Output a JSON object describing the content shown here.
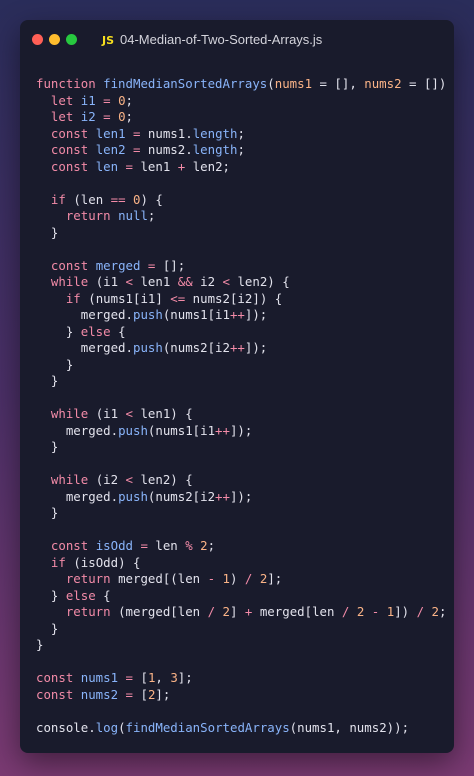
{
  "window": {
    "filename": "04-Median-of-Two-Sorted-Arrays.js",
    "language_badge": "JS"
  },
  "code_lines": [
    [
      [
        "kw",
        "function "
      ],
      [
        "fn",
        "findMedianSortedArrays"
      ],
      [
        "plain",
        "("
      ],
      [
        "param",
        "nums1"
      ],
      [
        "plain",
        " = [], "
      ],
      [
        "param",
        "nums2"
      ],
      [
        "plain",
        " = []) {"
      ]
    ],
    [
      [
        "plain",
        "  "
      ],
      [
        "kw",
        "let "
      ],
      [
        "var",
        "i1"
      ],
      [
        "op",
        " = "
      ],
      [
        "num",
        "0"
      ],
      [
        "plain",
        ";"
      ]
    ],
    [
      [
        "plain",
        "  "
      ],
      [
        "kw",
        "let "
      ],
      [
        "var",
        "i2"
      ],
      [
        "op",
        " = "
      ],
      [
        "num",
        "0"
      ],
      [
        "plain",
        ";"
      ]
    ],
    [
      [
        "plain",
        "  "
      ],
      [
        "kw",
        "const "
      ],
      [
        "var",
        "len1"
      ],
      [
        "op",
        " = "
      ],
      [
        "plain",
        "nums1."
      ],
      [
        "prop",
        "length"
      ],
      [
        "plain",
        ";"
      ]
    ],
    [
      [
        "plain",
        "  "
      ],
      [
        "kw",
        "const "
      ],
      [
        "var",
        "len2"
      ],
      [
        "op",
        " = "
      ],
      [
        "plain",
        "nums2."
      ],
      [
        "prop",
        "length"
      ],
      [
        "plain",
        ";"
      ]
    ],
    [
      [
        "plain",
        "  "
      ],
      [
        "kw",
        "const "
      ],
      [
        "var",
        "len"
      ],
      [
        "op",
        " = "
      ],
      [
        "plain",
        "len1 "
      ],
      [
        "op",
        "+"
      ],
      [
        "plain",
        " len2;"
      ]
    ],
    [],
    [
      [
        "plain",
        "  "
      ],
      [
        "kw",
        "if "
      ],
      [
        "plain",
        "(len "
      ],
      [
        "op",
        "=="
      ],
      [
        "plain",
        " "
      ],
      [
        "num",
        "0"
      ],
      [
        "plain",
        ") {"
      ]
    ],
    [
      [
        "plain",
        "    "
      ],
      [
        "kw",
        "return "
      ],
      [
        "var",
        "null"
      ],
      [
        "plain",
        ";"
      ]
    ],
    [
      [
        "plain",
        "  }"
      ]
    ],
    [],
    [
      [
        "plain",
        "  "
      ],
      [
        "kw",
        "const "
      ],
      [
        "var",
        "merged"
      ],
      [
        "op",
        " = "
      ],
      [
        "plain",
        "[];"
      ]
    ],
    [
      [
        "plain",
        "  "
      ],
      [
        "kw",
        "while "
      ],
      [
        "plain",
        "(i1 "
      ],
      [
        "op",
        "<"
      ],
      [
        "plain",
        " len1 "
      ],
      [
        "op",
        "&&"
      ],
      [
        "plain",
        " i2 "
      ],
      [
        "op",
        "<"
      ],
      [
        "plain",
        " len2) {"
      ]
    ],
    [
      [
        "plain",
        "    "
      ],
      [
        "kw",
        "if "
      ],
      [
        "plain",
        "(nums1[i1] "
      ],
      [
        "op",
        "<="
      ],
      [
        "plain",
        " nums2[i2]) {"
      ]
    ],
    [
      [
        "plain",
        "      merged."
      ],
      [
        "fn",
        "push"
      ],
      [
        "plain",
        "(nums1[i1"
      ],
      [
        "op",
        "++"
      ],
      [
        "plain",
        "]);"
      ]
    ],
    [
      [
        "plain",
        "    } "
      ],
      [
        "kw",
        "else"
      ],
      [
        "plain",
        " {"
      ]
    ],
    [
      [
        "plain",
        "      merged."
      ],
      [
        "fn",
        "push"
      ],
      [
        "plain",
        "(nums2[i2"
      ],
      [
        "op",
        "++"
      ],
      [
        "plain",
        "]);"
      ]
    ],
    [
      [
        "plain",
        "    }"
      ]
    ],
    [
      [
        "plain",
        "  }"
      ]
    ],
    [],
    [
      [
        "plain",
        "  "
      ],
      [
        "kw",
        "while "
      ],
      [
        "plain",
        "(i1 "
      ],
      [
        "op",
        "<"
      ],
      [
        "plain",
        " len1) {"
      ]
    ],
    [
      [
        "plain",
        "    merged."
      ],
      [
        "fn",
        "push"
      ],
      [
        "plain",
        "(nums1[i1"
      ],
      [
        "op",
        "++"
      ],
      [
        "plain",
        "]);"
      ]
    ],
    [
      [
        "plain",
        "  }"
      ]
    ],
    [],
    [
      [
        "plain",
        "  "
      ],
      [
        "kw",
        "while "
      ],
      [
        "plain",
        "(i2 "
      ],
      [
        "op",
        "<"
      ],
      [
        "plain",
        " len2) {"
      ]
    ],
    [
      [
        "plain",
        "    merged."
      ],
      [
        "fn",
        "push"
      ],
      [
        "plain",
        "(nums2[i2"
      ],
      [
        "op",
        "++"
      ],
      [
        "plain",
        "]);"
      ]
    ],
    [
      [
        "plain",
        "  }"
      ]
    ],
    [],
    [
      [
        "plain",
        "  "
      ],
      [
        "kw",
        "const "
      ],
      [
        "var",
        "isOdd"
      ],
      [
        "op",
        " = "
      ],
      [
        "plain",
        "len "
      ],
      [
        "op",
        "%"
      ],
      [
        "plain",
        " "
      ],
      [
        "num",
        "2"
      ],
      [
        "plain",
        ";"
      ]
    ],
    [
      [
        "plain",
        "  "
      ],
      [
        "kw",
        "if "
      ],
      [
        "plain",
        "(isOdd) {"
      ]
    ],
    [
      [
        "plain",
        "    "
      ],
      [
        "kw",
        "return "
      ],
      [
        "plain",
        "merged[(len "
      ],
      [
        "op",
        "-"
      ],
      [
        "plain",
        " "
      ],
      [
        "num",
        "1"
      ],
      [
        "plain",
        ") "
      ],
      [
        "op",
        "/"
      ],
      [
        "plain",
        " "
      ],
      [
        "num",
        "2"
      ],
      [
        "plain",
        "];"
      ]
    ],
    [
      [
        "plain",
        "  } "
      ],
      [
        "kw",
        "else"
      ],
      [
        "plain",
        " {"
      ]
    ],
    [
      [
        "plain",
        "    "
      ],
      [
        "kw",
        "return "
      ],
      [
        "plain",
        "(merged[len "
      ],
      [
        "op",
        "/"
      ],
      [
        "plain",
        " "
      ],
      [
        "num",
        "2"
      ],
      [
        "plain",
        "] "
      ],
      [
        "op",
        "+"
      ],
      [
        "plain",
        " merged[len "
      ],
      [
        "op",
        "/"
      ],
      [
        "plain",
        " "
      ],
      [
        "num",
        "2"
      ],
      [
        "plain",
        " "
      ],
      [
        "op",
        "-"
      ],
      [
        "plain",
        " "
      ],
      [
        "num",
        "1"
      ],
      [
        "plain",
        "]) "
      ],
      [
        "op",
        "/"
      ],
      [
        "plain",
        " "
      ],
      [
        "num",
        "2"
      ],
      [
        "plain",
        ";"
      ]
    ],
    [
      [
        "plain",
        "  }"
      ]
    ],
    [
      [
        "plain",
        "}"
      ]
    ],
    [],
    [
      [
        "kw",
        "const "
      ],
      [
        "var",
        "nums1"
      ],
      [
        "op",
        " = "
      ],
      [
        "plain",
        "["
      ],
      [
        "num",
        "1"
      ],
      [
        "plain",
        ", "
      ],
      [
        "num",
        "3"
      ],
      [
        "plain",
        "];"
      ]
    ],
    [
      [
        "kw",
        "const "
      ],
      [
        "var",
        "nums2"
      ],
      [
        "op",
        " = "
      ],
      [
        "plain",
        "["
      ],
      [
        "num",
        "2"
      ],
      [
        "plain",
        "];"
      ]
    ],
    [],
    [
      [
        "plain",
        "console."
      ],
      [
        "fn",
        "log"
      ],
      [
        "plain",
        "("
      ],
      [
        "fn",
        "findMedianSortedArrays"
      ],
      [
        "plain",
        "(nums1, nums2));"
      ]
    ]
  ]
}
